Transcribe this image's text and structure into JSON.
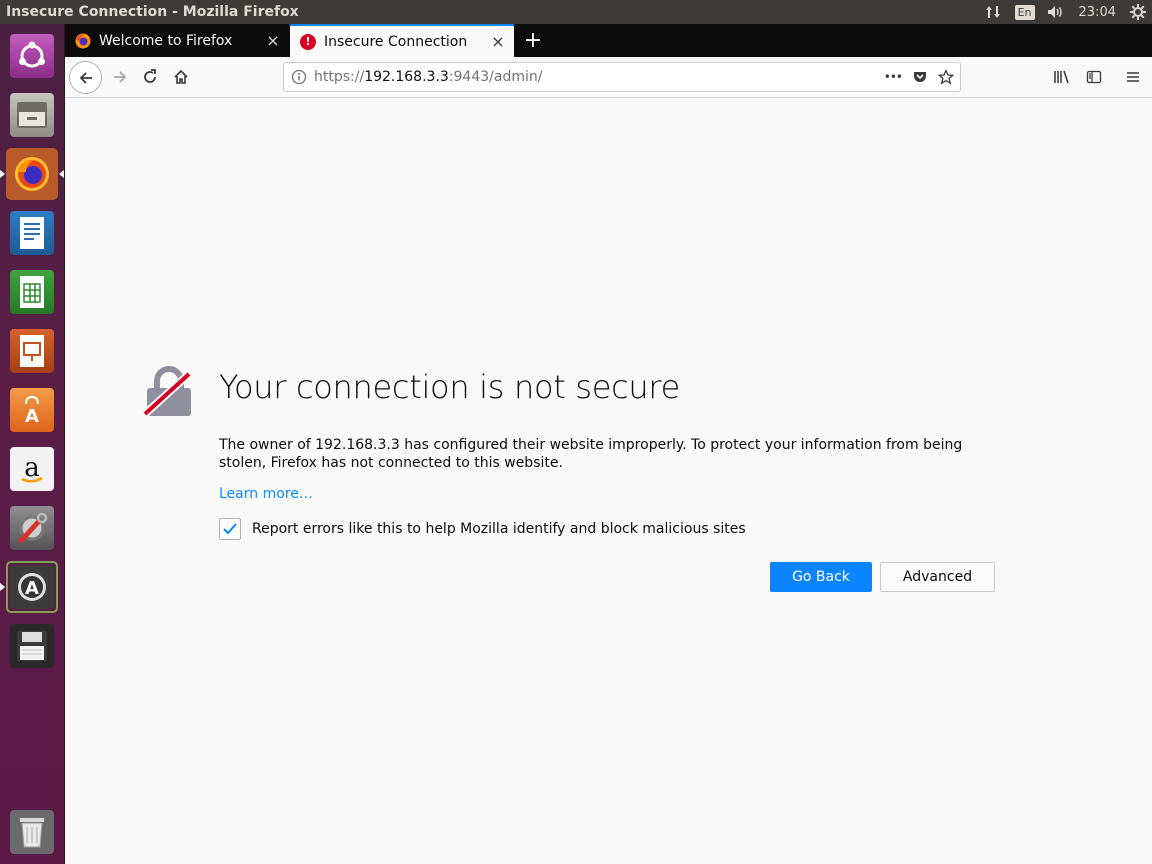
{
  "window": {
    "title": "Insecure Connection - Mozilla Firefox"
  },
  "panel": {
    "language": "En",
    "time": "23:04"
  },
  "launcher": {
    "items": [
      "ubuntu-dash",
      "files",
      "firefox",
      "writer",
      "calc",
      "impress",
      "software-center",
      "amazon",
      "system-settings",
      "software-updater",
      "save",
      "trash"
    ]
  },
  "tabs": [
    {
      "label": "Welcome to Firefox",
      "active": false,
      "close": "×"
    },
    {
      "label": "Insecure Connection",
      "active": true,
      "close": "×"
    }
  ],
  "newtab": "+",
  "address": {
    "scheme": "https://",
    "host": "192.168.3.3",
    "rest": ":9443/admin/",
    "page_actions": "•••"
  },
  "error": {
    "title": "Your connection is not secure",
    "description": "The owner of 192.168.3.3 has configured their website improperly. To protect your information from being stolen, Firefox has not connected to this website.",
    "learn_more": "Learn more…",
    "report_label": "Report errors like this to help Mozilla identify and block malicious sites",
    "report_checked": true,
    "go_back": "Go Back",
    "advanced": "Advanced"
  },
  "colors": {
    "accent": "#0a84ff",
    "launcher": "#5b1a46",
    "panel": "#3c3b37"
  }
}
